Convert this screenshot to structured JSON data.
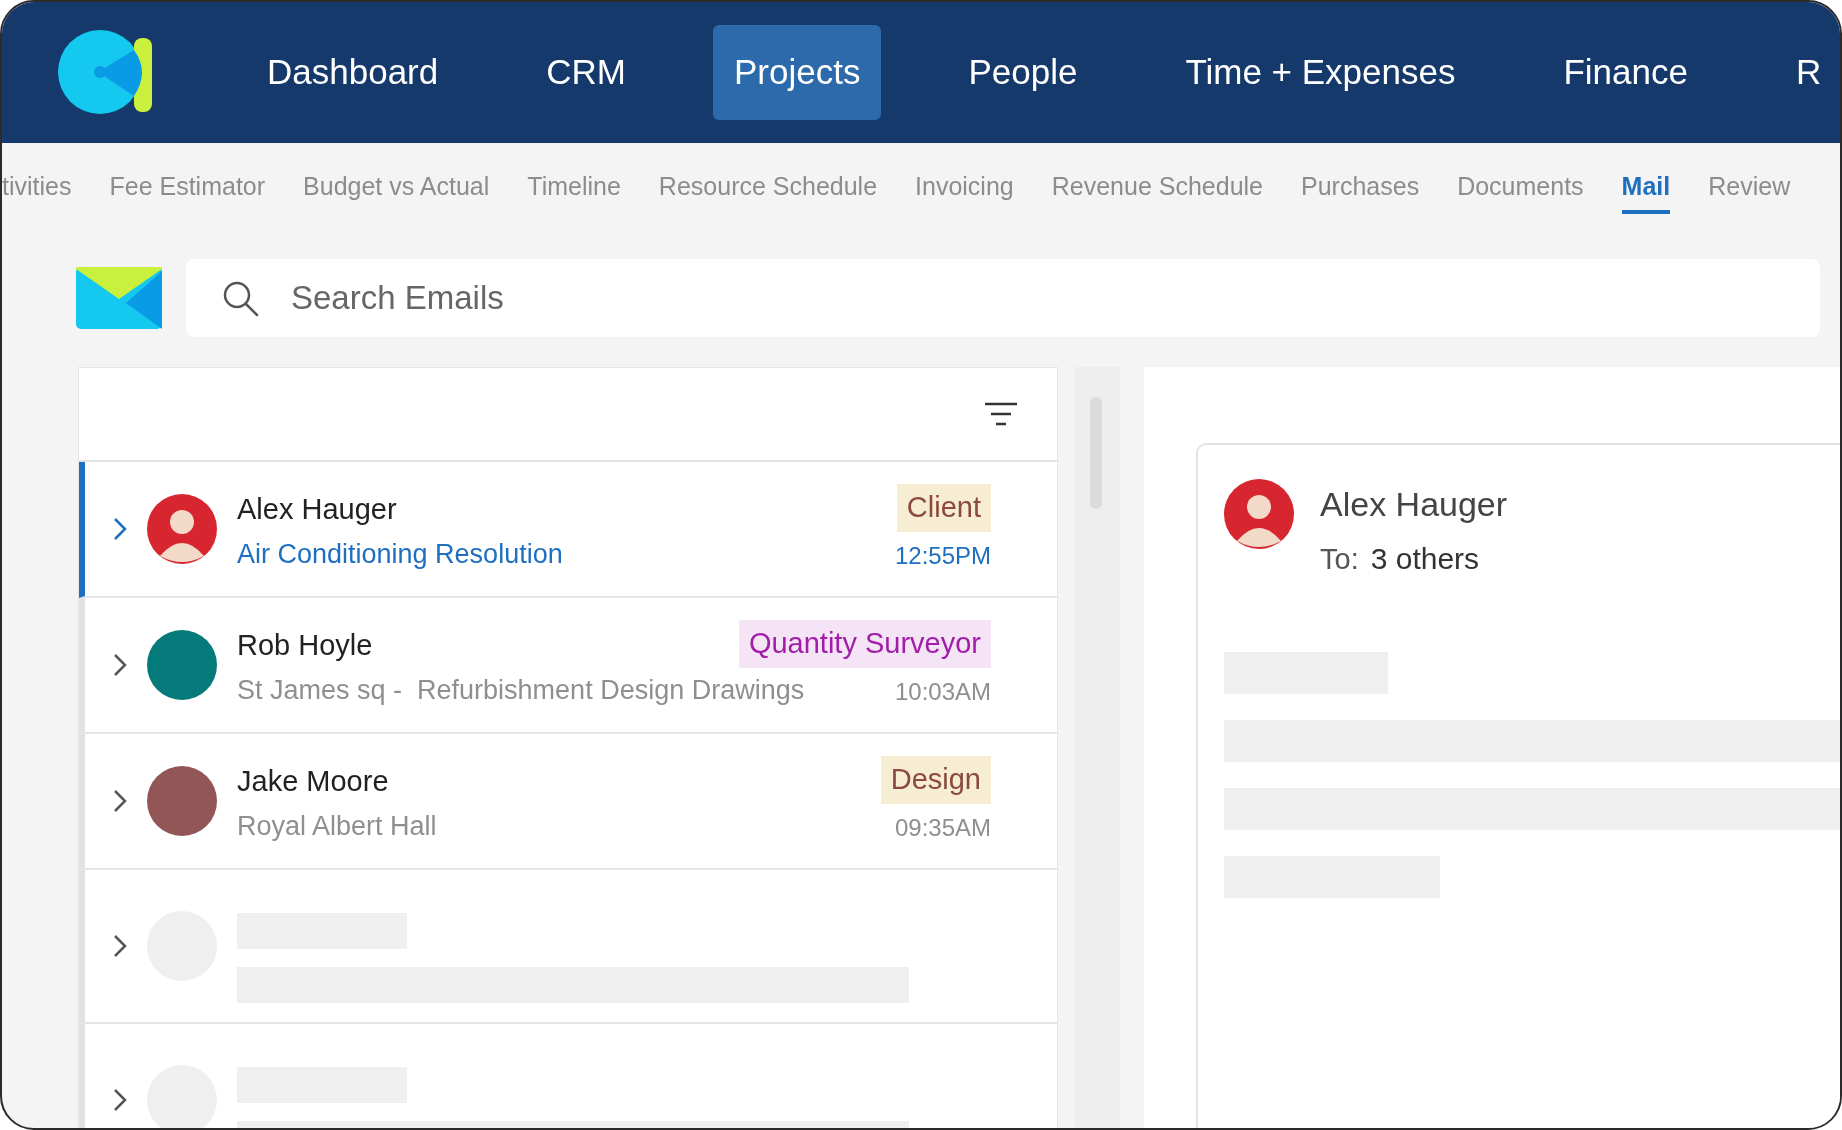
{
  "nav": {
    "items": [
      {
        "label": "Dashboard",
        "selected": false
      },
      {
        "label": "CRM",
        "selected": false
      },
      {
        "label": "Projects",
        "selected": true
      },
      {
        "label": "People",
        "selected": false
      },
      {
        "label": "Time + Expenses",
        "selected": false
      },
      {
        "label": "Finance",
        "selected": false
      },
      {
        "label": "R",
        "selected": false
      }
    ]
  },
  "subnav": {
    "items": [
      {
        "label": "tivities",
        "selected": false
      },
      {
        "label": "Fee Estimator",
        "selected": false
      },
      {
        "label": "Budget vs Actual",
        "selected": false
      },
      {
        "label": "Timeline",
        "selected": false
      },
      {
        "label": "Resource Schedule",
        "selected": false
      },
      {
        "label": "Invoicing",
        "selected": false
      },
      {
        "label": "Revenue Schedule",
        "selected": false
      },
      {
        "label": "Purchases",
        "selected": false
      },
      {
        "label": "Documents",
        "selected": false
      },
      {
        "label": "Mail",
        "selected": true
      },
      {
        "label": "Review",
        "selected": false
      }
    ]
  },
  "search": {
    "placeholder": "Search Emails"
  },
  "emails": [
    {
      "kind": "message",
      "selected": true,
      "sender": "Alex Hauger",
      "subject": "Air Conditioning Resolution",
      "tag": {
        "label": "Client",
        "color": "#8b4a3d"
      },
      "time": "12:55PM",
      "avatar": {
        "kind": "photo",
        "color": "#d7262f"
      }
    },
    {
      "kind": "message",
      "selected": false,
      "sender": "Rob Hoyle",
      "subject": "St James sq -  Refurbishment Design Drawings",
      "tag": {
        "label": "Quantity Surveyor",
        "color": "#a11fa8"
      },
      "time": "10:03AM",
      "avatar": {
        "kind": "plain",
        "color": "#047a7a"
      }
    },
    {
      "kind": "message",
      "selected": false,
      "sender": "Jake Moore",
      "subject": "Royal Albert Hall",
      "tag": {
        "label": "Design",
        "color": "#8b4a3d"
      },
      "time": "09:35AM",
      "avatar": {
        "kind": "plain",
        "color": "#935656"
      }
    },
    {
      "kind": "placeholder",
      "selected": false
    },
    {
      "kind": "placeholder",
      "selected": false
    }
  ],
  "preview": {
    "sender": "Alex Hauger",
    "to_label": "To:",
    "recipients": "3 others"
  }
}
